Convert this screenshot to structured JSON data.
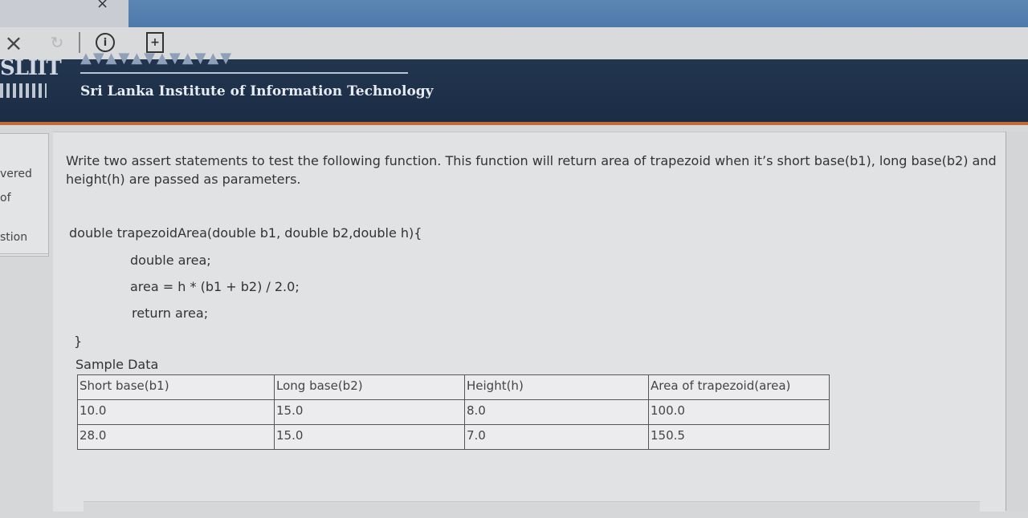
{
  "browser": {
    "close_glyph": "×",
    "reload_glyph": "↻",
    "info_glyph": "i",
    "newdoc_glyph": "+",
    "tab_close_glyph": "×"
  },
  "header": {
    "logo_text": "SLIIT",
    "institute_name": "Sri Lanka Institute of Information Technology"
  },
  "sidebar": {
    "item1": "vered",
    "item2": "of",
    "item3": "stion"
  },
  "question": {
    "text": "Write two assert statements to test the following function. This function will return area of trapezoid when it’s short base(b1), long base(b2) and height(h) are passed as parameters.",
    "code_line1": "double trapezoidArea(double b1, double b2,double h){",
    "code_line2": "double area;",
    "code_line3": "area = h * (b1 + b2) / 2.0;",
    "code_line4": "return area;",
    "code_line5": "}",
    "sample_label": "Sample Data"
  },
  "table": {
    "headers": [
      "Short base(b1)",
      "Long base(b2)",
      "Height(h)",
      "Area of trapezoid(area)"
    ],
    "rows": [
      [
        "10.0",
        "15.0",
        "8.0",
        "100.0"
      ],
      [
        "28.0",
        "15.0",
        "7.0",
        "150.5"
      ]
    ]
  }
}
